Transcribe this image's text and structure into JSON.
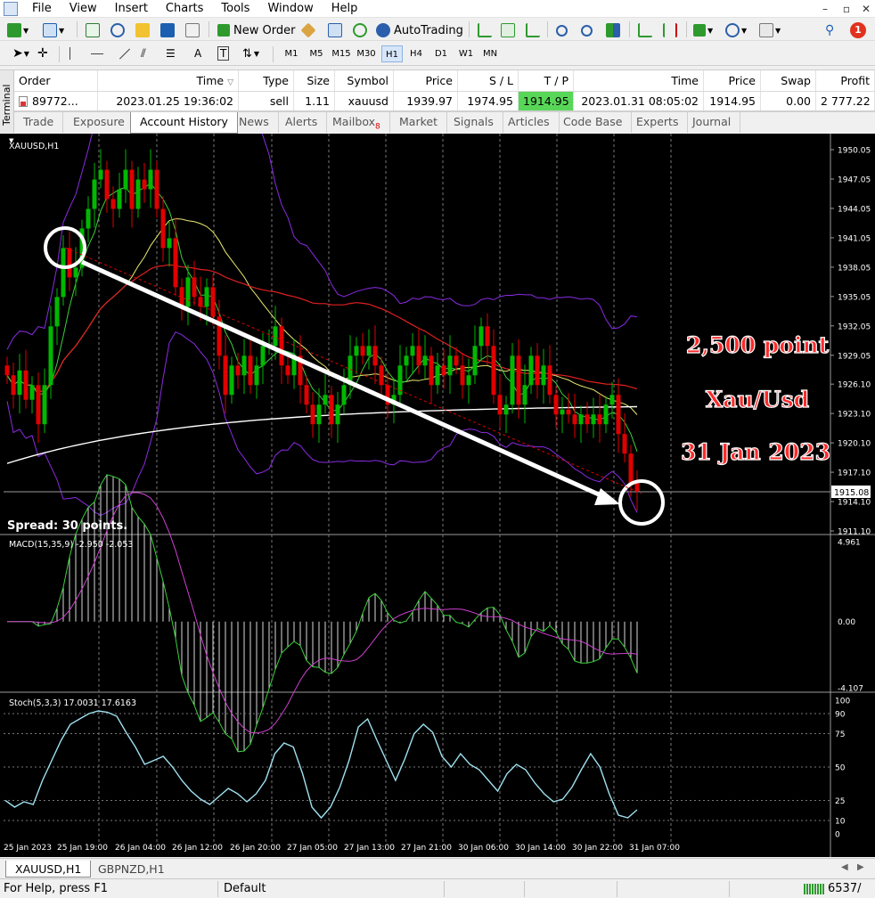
{
  "menu": [
    "File",
    "View",
    "Insert",
    "Charts",
    "Tools",
    "Window",
    "Help"
  ],
  "toolbar": {
    "new_order": "New Order",
    "autotrading": "AutoTrading"
  },
  "timeframes": [
    "M1",
    "M5",
    "M15",
    "M30",
    "H1",
    "H4",
    "D1",
    "W1",
    "MN"
  ],
  "active_timeframe": "H1",
  "terminal": {
    "side_label": "Terminal",
    "columns": [
      "Order",
      "Time",
      "Type",
      "Size",
      "Symbol",
      "Price",
      "S / L",
      "T / P",
      "Time",
      "Price",
      "Swap",
      "Profit"
    ],
    "row": {
      "order": "89772...",
      "open_time": "2023.01.25 19:36:02",
      "type": "sell",
      "size": "1.11",
      "symbol": "xauusd",
      "price": "1939.97",
      "sl": "1974.95",
      "tp": "1914.95",
      "close_time": "2023.01.31 08:05:02",
      "close_price": "1914.95",
      "swap": "0.00",
      "profit": "2 777.22"
    },
    "tabs": [
      "Trade",
      "Exposure",
      "Account History",
      "News",
      "Alerts",
      "Mailbox",
      "Market",
      "Signals",
      "Articles",
      "Code Base",
      "Experts",
      "Journal"
    ],
    "mailbox_badge": "8",
    "active_tab": "Account History"
  },
  "chart": {
    "symbol_label": "XAUUSD,H1",
    "spread_text": "Spread: 30 points.",
    "current_price": "1915.08",
    "macd_label": "MACD(15,35,9) -2.950 -2.053",
    "stoch_label": "Stoch(5,3,3) 17.0031 17.6163",
    "annotation": {
      "line1": "2,500 point",
      "line2": "Xau/Usd",
      "line3": "31 Jan 2023"
    },
    "colors": {
      "bull": "#00b800",
      "bear": "#e00000",
      "annotation": "#ff1e1e",
      "background": "#000000"
    }
  },
  "chart_data": {
    "type": "candlestick",
    "price_axis_labels": [
      "1950.05",
      "1947.05",
      "1944.05",
      "1941.05",
      "1938.05",
      "1935.05",
      "1932.05",
      "1929.05",
      "1926.10",
      "1923.10",
      "1920.10",
      "1917.10",
      "1914.10",
      "1911.10"
    ],
    "macd_axis_labels": [
      "4.961",
      "0.00",
      "-4.107"
    ],
    "stoch_axis_labels": [
      "100",
      "90",
      "75",
      "50",
      "25",
      "10",
      "0"
    ],
    "time_labels": [
      "25 Jan 2023",
      "25 Jan 19:00",
      "26 Jan 04:00",
      "26 Jan 12:00",
      "26 Jan 20:00",
      "27 Jan 05:00",
      "27 Jan 13:00",
      "27 Jan 21:00",
      "30 Jan 06:00",
      "30 Jan 14:00",
      "30 Jan 22:00",
      "31 Jan 07:00"
    ],
    "ylim_price": [
      1911.1,
      1950.05
    ],
    "closes": [
      1927,
      1925,
      1927.5,
      1924.5,
      1926,
      1922,
      1926,
      1932,
      1935,
      1940,
      1937,
      1938,
      1942,
      1944,
      1947,
      1948,
      1945,
      1944,
      1946,
      1948,
      1944,
      1947,
      1946,
      1948,
      1944,
      1940,
      1941,
      1936,
      1934,
      1937,
      1935,
      1934,
      1936,
      1933,
      1929,
      1925,
      1928,
      1927,
      1929,
      1926,
      1928,
      1930,
      1930,
      1932,
      1928,
      1927,
      1929,
      1926,
      1924,
      1922,
      1924,
      1925,
      1922,
      1924,
      1926,
      1929,
      1930,
      1929,
      1930,
      1928,
      1926,
      1924,
      1925,
      1928,
      1929,
      1930,
      1928,
      1929,
      1926,
      1928,
      1927,
      1929,
      1928,
      1926,
      1927,
      1930,
      1932,
      1930,
      1925,
      1923,
      1924,
      1929,
      1924,
      1926,
      1929,
      1926,
      1928,
      1925,
      1923,
      1923.5,
      1923,
      1922,
      1923,
      1922,
      1923,
      1922,
      1924,
      1925,
      1921,
      1919,
      1916,
      1915.08
    ],
    "stochastic_k": [
      25,
      20,
      24,
      22,
      40,
      55,
      70,
      82,
      86,
      90,
      92,
      91,
      88,
      76,
      65,
      52,
      55,
      58,
      50,
      40,
      32,
      26,
      22,
      28,
      34,
      30,
      24,
      30,
      40,
      60,
      68,
      65,
      45,
      20,
      12,
      20,
      35,
      55,
      80,
      86,
      70,
      55,
      40,
      56,
      75,
      82,
      76,
      58,
      50,
      60,
      52,
      48,
      40,
      32,
      45,
      52,
      48,
      38,
      30,
      24,
      26,
      35,
      48,
      60,
      50,
      30,
      14,
      12,
      18
    ],
    "trade": {
      "entry_price": 1939.97,
      "exit_price": 1914.95,
      "entry_time": "2023.01.25 19:36:02",
      "exit_time": "2023.01.31 08:05:02"
    }
  },
  "chart_tabs": [
    "XAUUSD,H1",
    "GBPNZD,H1"
  ],
  "status": {
    "help": "For Help, press F1",
    "profile": "Default",
    "traffic": "6537/"
  }
}
